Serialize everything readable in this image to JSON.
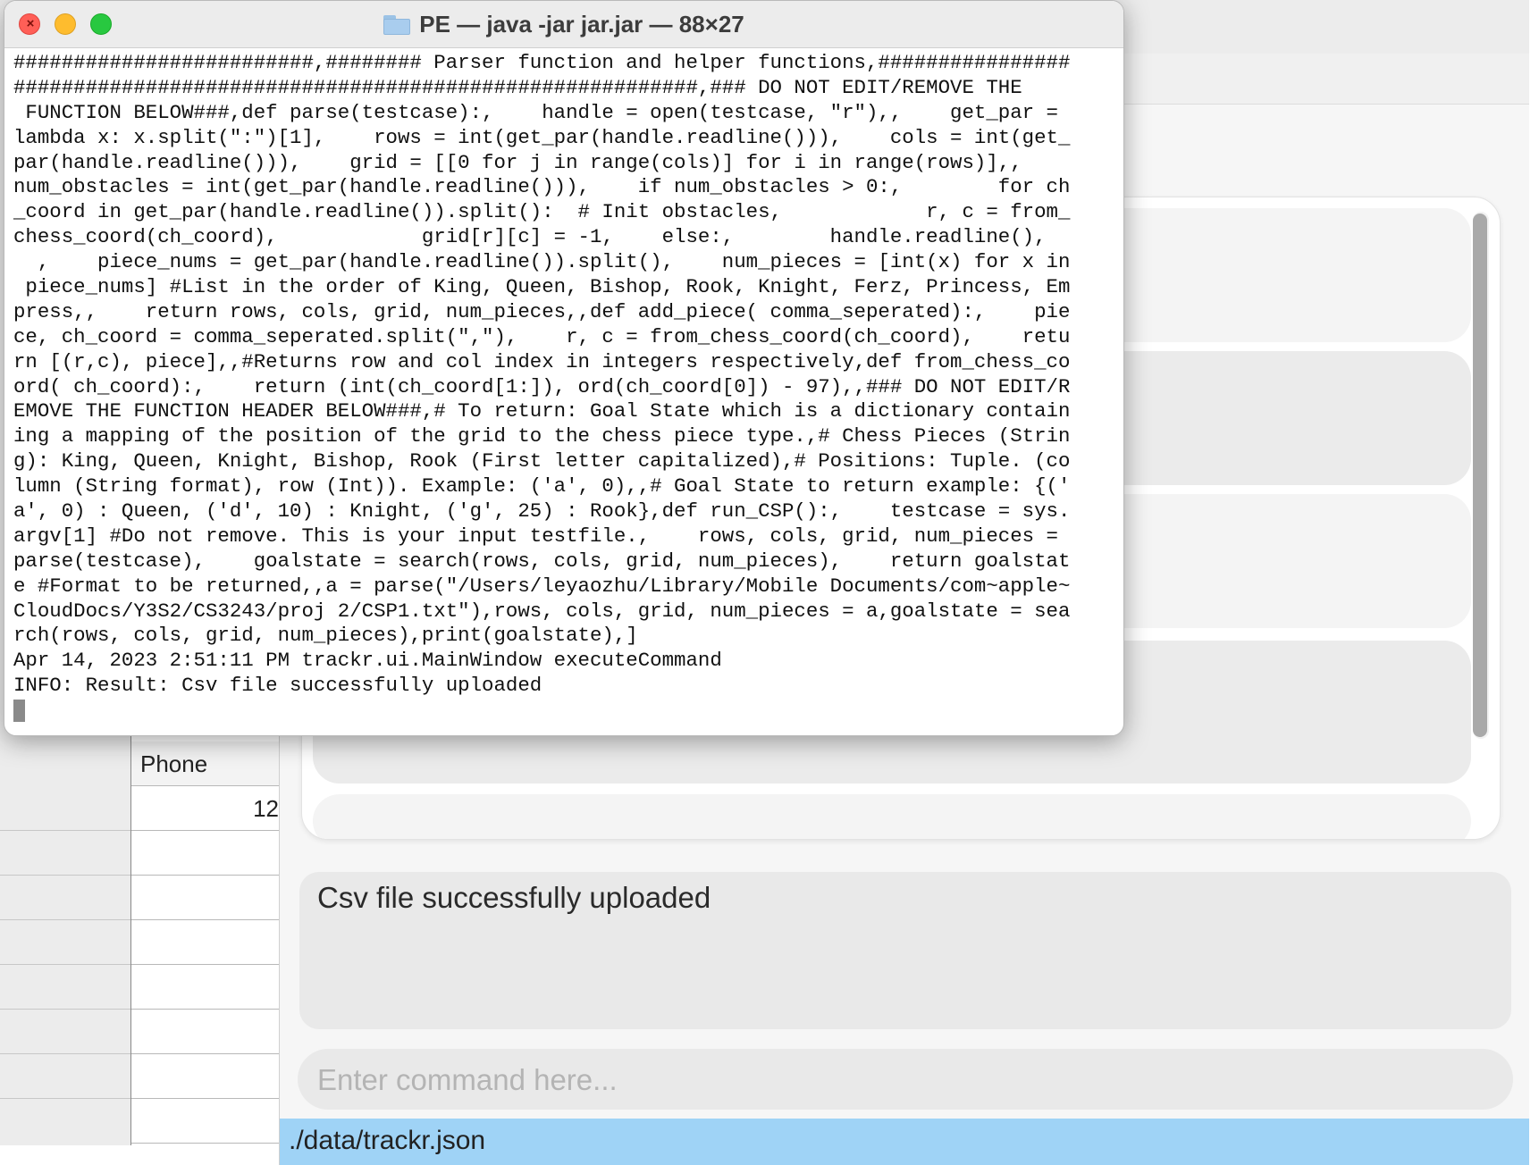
{
  "terminal": {
    "title": "PE — java -jar jar.jar — 88×27",
    "lines": [
      "#########################,######## Parser function and helper functions,################",
      "#########################################################,### DO NOT EDIT/REMOVE THE",
      " FUNCTION BELOW###,def parse(testcase):,    handle = open(testcase, \"r\"),,    get_par =",
      "lambda x: x.split(\":\")[1],    rows = int(get_par(handle.readline())),    cols = int(get_",
      "par(handle.readline())),    grid = [[0 for j in range(cols)] for i in range(rows)],,",
      "num_obstacles = int(get_par(handle.readline())),    if num_obstacles > 0:,        for ch",
      "_coord in get_par(handle.readline()).split():  # Init obstacles,            r, c = from_",
      "chess_coord(ch_coord),            grid[r][c] = -1,    else:,        handle.readline(),",
      "  ,    piece_nums = get_par(handle.readline()).split(),    num_pieces = [int(x) for x in",
      " piece_nums] #List in the order of King, Queen, Bishop, Rook, Knight, Ferz, Princess, Em",
      "press,,    return rows, cols, grid, num_pieces,,def add_piece( comma_seperated):,    pie",
      "ce, ch_coord = comma_seperated.split(\",\"),    r, c = from_chess_coord(ch_coord),    retu",
      "rn [(r,c), piece],,#Returns row and col index in integers respectively,def from_chess_co",
      "ord( ch_coord):,    return (int(ch_coord[1:]), ord(ch_coord[0]) - 97),,### DO NOT EDIT/R",
      "EMOVE THE FUNCTION HEADER BELOW###,# To return: Goal State which is a dictionary contain",
      "ing a mapping of the position of the grid to the chess piece type.,# Chess Pieces (Strin",
      "g): King, Queen, Knight, Bishop, Rook (First letter capitalized),# Positions: Tuple. (co",
      "lumn (String format), row (Int)). Example: ('a', 0),,# Goal State to return example: {('",
      "a', 0) : Queen, ('d', 10) : Knight, ('g', 25) : Rook},def run_CSP():,    testcase = sys.",
      "argv[1] #Do not remove. This is your input testfile.,    rows, cols, grid, num_pieces =",
      "parse(testcase),    goalstate = search(rows, cols, grid, num_pieces),    return goalstat",
      "e #Format to be returned,,a = parse(\"/Users/leyaozhu/Library/Mobile Documents/com~apple~",
      "CloudDocs/Y3S2/CS3243/proj 2/CSP1.txt\"),rows, cols, grid, num_pieces = a,goalstate = sea",
      "rch(rows, cols, grid, num_pieces),print(goalstate),]",
      "Apr 14, 2023 2:51:11 PM trackr.ui.MainWindow executeCommand",
      "INFO: Result: Csv file successfully uploaded"
    ]
  },
  "spreadsheet": {
    "header": "Phone",
    "first_value": "12"
  },
  "trackr": {
    "result_text": "Csv file successfully uploaded",
    "command_placeholder": "Enter command here...",
    "status_path": "./data/trackr.json"
  },
  "colors": {
    "status_bar": "#9fd3f6",
    "close": "#ff5f57",
    "minimize": "#febc2e",
    "zoom": "#28c840"
  }
}
